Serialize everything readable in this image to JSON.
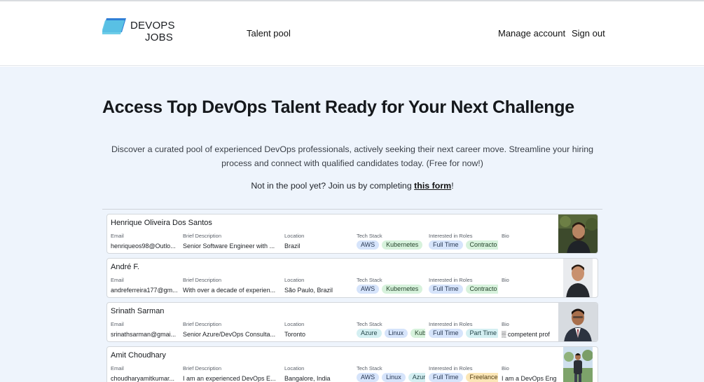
{
  "brand": {
    "line1": "DEVOPS",
    "line2": "JOBS",
    "mark_colors": [
      "#5ec8e6",
      "#2f7fd6"
    ]
  },
  "nav": {
    "talent_pool": "Talent pool",
    "manage_account": "Manage account",
    "sign_out": "Sign out"
  },
  "hero": {
    "title": "Access Top DevOps Talent Ready for Your Next Challenge",
    "description": "Discover a curated pool of experienced DevOps professionals, actively seeking their next career move. Streamline your hiring process and connect with qualified candidates today. (Free for now!)",
    "join_prefix": "Not in the pool yet? Join us by completing ",
    "join_link": "this form",
    "join_suffix": "!"
  },
  "columns": {
    "email": "Email",
    "brief": "Brief Description",
    "location": "Location",
    "stack": "Tech Stack",
    "roles": "Interested in Roles",
    "bio": "Bio"
  },
  "candidates": [
    {
      "name": "Henrique Oliveira Dos Santos",
      "email": "henriqueos98@Outlo...",
      "brief": "Senior Software Engineer with ...",
      "location": "Brazil",
      "stack": [
        {
          "label": "AWS",
          "color": "blue"
        },
        {
          "label": "Kubernetes",
          "color": "green"
        }
      ],
      "roles": [
        {
          "label": "Full Time",
          "color": "blue"
        },
        {
          "label": "Contracto",
          "color": "green"
        }
      ],
      "bio": "",
      "photo": "avatar-outdoor"
    },
    {
      "name": "André F.",
      "email": "andreferreira177@gm...",
      "brief": "With over a decade of experien...",
      "location": "São Paulo, Brazil",
      "stack": [
        {
          "label": "AWS",
          "color": "blue"
        },
        {
          "label": "Kubernetes",
          "color": "green"
        }
      ],
      "roles": [
        {
          "label": "Full Time",
          "color": "blue"
        },
        {
          "label": "Contracto",
          "color": "green"
        }
      ],
      "bio": "",
      "photo": "avatar-portrait"
    },
    {
      "name": "Srinath Sarman",
      "email": "srinathsarman@gmai...",
      "brief": "Senior Azure/DevOps Consulta...",
      "location": "Toronto",
      "stack": [
        {
          "label": "Azure",
          "color": "teal"
        },
        {
          "label": "Linux",
          "color": "blue"
        },
        {
          "label": "Kub",
          "color": "green"
        }
      ],
      "roles": [
        {
          "label": "Full Time",
          "color": "blue"
        },
        {
          "label": "Part Time",
          "color": "teal"
        }
      ],
      "bio": "▒ competent prof",
      "photo": "avatar-suit"
    },
    {
      "name": "Amit Choudhary",
      "email": "choudharyamitkumar...",
      "brief": "I am an experienced DevOps E...",
      "location": "Bangalore, India",
      "stack": [
        {
          "label": "AWS",
          "color": "blue"
        },
        {
          "label": "Linux",
          "color": "blue"
        },
        {
          "label": "Azure",
          "color": "teal"
        }
      ],
      "roles": [
        {
          "label": "Full Time",
          "color": "blue"
        },
        {
          "label": "Freelance",
          "color": "yellow"
        }
      ],
      "bio": "I am a DevOps Eng",
      "photo": "avatar-standing"
    }
  ]
}
